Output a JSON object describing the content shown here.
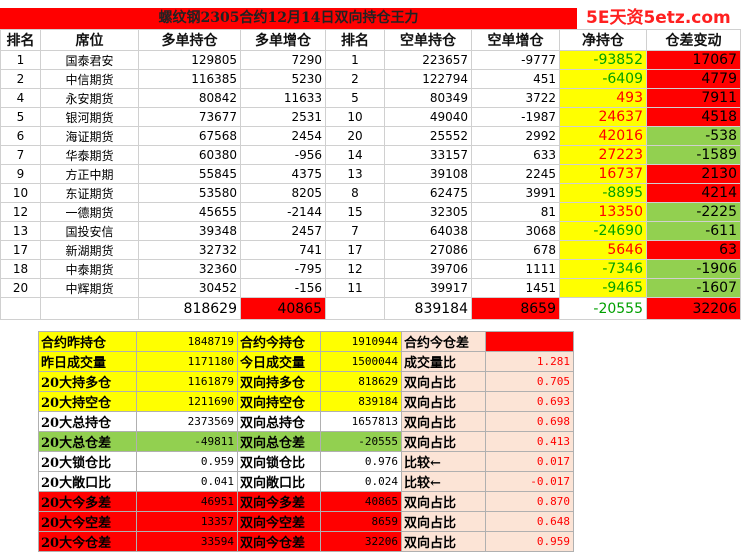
{
  "title": "螺纹钢2305合约12月14日双向持仓王力",
  "watermark": "5E天资5etz.com",
  "headers": [
    "排名",
    "席位",
    "多单持仓",
    "多单增仓",
    "排名",
    "空单持仓",
    "空单增仓",
    "净持仓",
    "仓差变动"
  ],
  "rows": [
    {
      "rank": "1",
      "name": "国泰君安",
      "long": "129805",
      "long_chg": "7290",
      "srank": "1",
      "short": "223657",
      "short_chg": "-9777",
      "net": "-93852",
      "diff": "17067"
    },
    {
      "rank": "2",
      "name": "中信期货",
      "long": "116385",
      "long_chg": "5230",
      "srank": "2",
      "short": "122794",
      "short_chg": "451",
      "net": "-6409",
      "diff": "4779"
    },
    {
      "rank": "4",
      "name": "永安期货",
      "long": "80842",
      "long_chg": "11633",
      "srank": "5",
      "short": "80349",
      "short_chg": "3722",
      "net": "493",
      "diff": "7911"
    },
    {
      "rank": "5",
      "name": "银河期货",
      "long": "73677",
      "long_chg": "2531",
      "srank": "10",
      "short": "49040",
      "short_chg": "-1987",
      "net": "24637",
      "diff": "4518"
    },
    {
      "rank": "6",
      "name": "海证期货",
      "long": "67568",
      "long_chg": "2454",
      "srank": "20",
      "short": "25552",
      "short_chg": "2992",
      "net": "42016",
      "diff": "-538"
    },
    {
      "rank": "7",
      "name": "华泰期货",
      "long": "60380",
      "long_chg": "-956",
      "srank": "14",
      "short": "33157",
      "short_chg": "633",
      "net": "27223",
      "diff": "-1589"
    },
    {
      "rank": "9",
      "name": "方正中期",
      "long": "55845",
      "long_chg": "4375",
      "srank": "13",
      "short": "39108",
      "short_chg": "2245",
      "net": "16737",
      "diff": "2130"
    },
    {
      "rank": "10",
      "name": "东证期货",
      "long": "53580",
      "long_chg": "8205",
      "srank": "8",
      "short": "62475",
      "short_chg": "3991",
      "net": "-8895",
      "diff": "4214"
    },
    {
      "rank": "12",
      "name": "一德期货",
      "long": "45655",
      "long_chg": "-2144",
      "srank": "15",
      "short": "32305",
      "short_chg": "81",
      "net": "13350",
      "diff": "-2225"
    },
    {
      "rank": "13",
      "name": "国投安信",
      "long": "39348",
      "long_chg": "2457",
      "srank": "7",
      "short": "64038",
      "short_chg": "3068",
      "net": "-24690",
      "diff": "-611"
    },
    {
      "rank": "17",
      "name": "新湖期货",
      "long": "32732",
      "long_chg": "741",
      "srank": "17",
      "short": "27086",
      "short_chg": "678",
      "net": "5646",
      "diff": "63"
    },
    {
      "rank": "18",
      "name": "中泰期货",
      "long": "32360",
      "long_chg": "-795",
      "srank": "12",
      "short": "39706",
      "short_chg": "1111",
      "net": "-7346",
      "diff": "-1906"
    },
    {
      "rank": "20",
      "name": "中辉期货",
      "long": "30452",
      "long_chg": "-156",
      "srank": "11",
      "short": "39917",
      "short_chg": "1451",
      "net": "-9465",
      "diff": "-1607"
    }
  ],
  "totals": {
    "long": "818629",
    "long_chg": "40865",
    "short": "839184",
    "short_chg": "8659",
    "net": "-20555",
    "diff": "32206"
  },
  "stats": [
    [
      "合约昨持仓",
      "1848719",
      "合约今持仓",
      "1910944",
      "合约今仓差",
      "62225"
    ],
    [
      "昨日成交量",
      "1171180",
      "今日成交量",
      "1500044",
      "成交量比",
      "1.281"
    ],
    [
      "20大持多仓",
      "1161879",
      "双向持多仓",
      "818629",
      "双向占比",
      "0.705"
    ],
    [
      "20大持空仓",
      "1211690",
      "双向持空仓",
      "839184",
      "双向占比",
      "0.693"
    ],
    [
      "20大总持仓",
      "2373569",
      "双向总持仓",
      "1657813",
      "双向占比",
      "0.698"
    ],
    [
      "20大总仓差",
      "-49811",
      "双向总仓差",
      "-20555",
      "双向占比",
      "0.413"
    ],
    [
      "20大锁仓比",
      "0.959",
      "双向锁仓比",
      "0.976",
      "比较←",
      "0.017"
    ],
    [
      "20大敞口比",
      "0.041",
      "双向敞口比",
      "0.024",
      "比较←",
      "-0.017"
    ],
    [
      "20大今多差",
      "46951",
      "双向今多差",
      "40865",
      "双向占比",
      "0.870"
    ],
    [
      "20大今空差",
      "13357",
      "双向今空差",
      "8659",
      "双向占比",
      "0.648"
    ],
    [
      "20大今仓差",
      "33594",
      "双向今仓差",
      "32206",
      "双向占比",
      "0.959"
    ]
  ],
  "colors": {
    "red": "#ff0000",
    "yellow": "#ffff00",
    "green": "#92d050",
    "pink": "#fce4d6"
  }
}
